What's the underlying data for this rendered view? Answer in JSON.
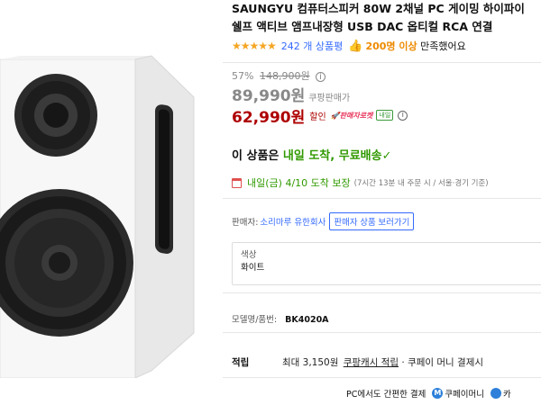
{
  "product": {
    "title_line1": "SAUNGYU 컴퓨터스피커 80W 2채널 PC 게이밍 하이파이",
    "title_line2": "쉘프 액티브 앰프내장형 USB DAC 옵티컬 RCA 연결"
  },
  "rating": {
    "stars": "★★★★★",
    "review_count": "242 개 상품평",
    "satisfied_count": "200명 이상",
    "satisfied_text": "만족했어요"
  },
  "price": {
    "discount_rate": "57%",
    "original_price": "148,900원",
    "info_icon": "ⓘ",
    "coupang_price": "89,990원",
    "coupang_label": "쿠팡판매가",
    "sale_price": "62,990원",
    "sale_label": "할인",
    "seller_rocket": "🚀판매자로켓",
    "tomorrow_badge": "내일"
  },
  "delivery": {
    "headline_prefix": "이 상품은",
    "headline_green": "내일 도착, 무료배송",
    "check": "✓",
    "date_text": "내일(금) 4/10 도착 보장",
    "note": "(7시간 13분 내 주문 시 / 서울·경기 기준)"
  },
  "seller": {
    "label": "판매자:",
    "name": "소리마루 유한회사",
    "button": "판매자 상품 보러가기"
  },
  "option": {
    "title": "색상",
    "value": "화이트"
  },
  "model": {
    "label": "모델명/품번:",
    "value": "BK4020A"
  },
  "reward": {
    "label": "적립",
    "text_prefix": "최대 3,150원",
    "link": "쿠팡캐시 적립",
    "text_suffix": "· 쿠페이 머니 결제시"
  },
  "pay": {
    "text": "PC에서도 간편한 결제",
    "icon_letter": "M",
    "pay_name": "쿠페이머니",
    "pay_name2": "카"
  },
  "colors": {
    "sale_red": "#ae0000",
    "link_blue": "#346aff",
    "delivery_green": "#309900",
    "star_yellow": "#f5a623"
  }
}
